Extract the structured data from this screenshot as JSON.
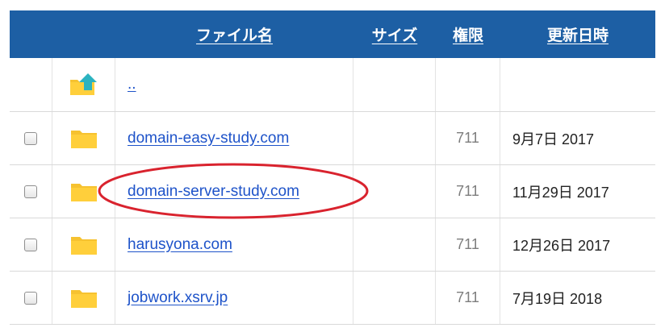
{
  "header": {
    "name_label": "ファイル名",
    "size_label": "サイズ",
    "perm_label": "権限",
    "date_label": "更新日時",
    "bg_color": "#1d5fa4"
  },
  "parent_row": {
    "name": "..",
    "icon": "folder-up-icon"
  },
  "rows": [
    {
      "name": "domain-easy-study.com",
      "permission": "711",
      "modified": "9月7日 2017",
      "icon": "folder-icon"
    },
    {
      "name": "domain-server-study.com",
      "permission": "711",
      "modified": "11月29日 2017",
      "icon": "folder-icon",
      "highlighted": true
    },
    {
      "name": "harusyona.com",
      "permission": "711",
      "modified": "12月26日 2017",
      "icon": "folder-icon"
    },
    {
      "name": "jobwork.xsrv.jp",
      "permission": "711",
      "modified": "7月19日 2018",
      "icon": "folder-icon"
    }
  ],
  "annotation": {
    "shape": "ellipse",
    "color": "#d9232e"
  },
  "folder_color": "#f6c230",
  "up_arrow_color": "#2bb3c0"
}
